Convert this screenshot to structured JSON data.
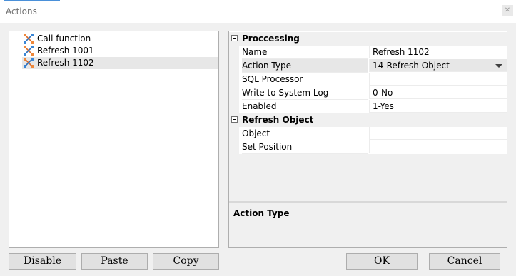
{
  "window": {
    "title": "Actions",
    "close_glyph": "✕"
  },
  "tree": {
    "items": [
      {
        "label": "Call function",
        "icon": "action-icon"
      },
      {
        "label": "Refresh 1001",
        "icon": "action-icon"
      },
      {
        "label": "Refresh 1102",
        "icon": "action-icon",
        "selected": true
      }
    ]
  },
  "properties": {
    "categories": [
      {
        "label": "Proccessing",
        "rows": [
          {
            "name": "Name",
            "value": "Refresh 1102"
          },
          {
            "name": "Action Type",
            "value": "14-Refresh Object",
            "selected": true,
            "dropdown": true
          },
          {
            "name": "SQL Processor",
            "value": ""
          },
          {
            "name": "Write to System Log",
            "value": "0-No"
          },
          {
            "name": "Enabled",
            "value": "1-Yes"
          }
        ]
      },
      {
        "label": "Refresh Object",
        "rows": [
          {
            "name": "Object",
            "value": ""
          },
          {
            "name": "Set Position",
            "value": ""
          }
        ]
      }
    ],
    "description_title": "Action Type"
  },
  "buttons": {
    "disable": "Disable",
    "paste": "Paste",
    "copy": "Copy",
    "ok": "OK",
    "cancel": "Cancel"
  },
  "colors": {
    "icon_orange": "#f0883a",
    "icon_blue": "#3a86d6",
    "selection": "#e7e7e7"
  }
}
